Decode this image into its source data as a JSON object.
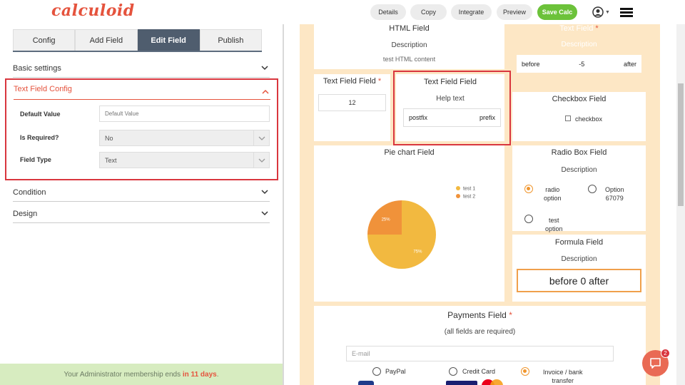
{
  "app": {
    "logo": "calculoid"
  },
  "nav": {
    "details": "Details",
    "copy": "Copy",
    "integrate": "Integrate",
    "preview": "Preview",
    "save": "Save Calc",
    "user_icon": "user-icon",
    "menu_icon": "hamburger-icon"
  },
  "tabs": [
    {
      "label": "Config"
    },
    {
      "label": "Add Field"
    },
    {
      "label": "Edit Field"
    },
    {
      "label": "Publish"
    }
  ],
  "sections": {
    "basic": "Basic settings",
    "config": "Text Field Config",
    "condition": "Condition",
    "design": "Design"
  },
  "form": {
    "default_value_label": "Default Value",
    "default_value_placeholder": "Default Value",
    "required_label": "Is Required?",
    "required_value": "No",
    "type_label": "Field Type",
    "type_value": "Text"
  },
  "membership": {
    "prefix": "Your Administrator membership ends ",
    "highlight": "in 11 days",
    "suffix": "."
  },
  "preview": {
    "html_field": {
      "title": "HTML Field",
      "desc": "Description",
      "content": "test HTML content"
    },
    "text_field_top": {
      "title": "Text Field",
      "req": "*",
      "desc": "Description",
      "before": "before",
      "value": "-5",
      "after": "after"
    },
    "text_field_field": {
      "title": "Text Field Field",
      "req": "*",
      "value": "12"
    },
    "text_field_field2": {
      "title": "Text Field Field",
      "help": "Help text",
      "left": "postfix",
      "right": "prefix"
    },
    "checkbox": {
      "title": "Checkbox Field",
      "label": "checkbox"
    },
    "pie": {
      "title": "Pie chart Field"
    },
    "radio": {
      "title": "Radio Box Field",
      "desc": "Description",
      "opt1": "radio",
      "opt1b": "option",
      "opt2": "Option",
      "opt2b": "67079",
      "opt3": "test",
      "opt3b": "option"
    },
    "formula": {
      "title": "Formula Field",
      "desc": "Description",
      "value": "before 0 after"
    },
    "payments": {
      "title": "Payments Field",
      "req": "*",
      "desc": "(all fields are required)",
      "email_placeholder": "E-mail",
      "paypal": "PayPal",
      "card": "Credit Card",
      "invoice": "Invoice / bank",
      "invoice2": "transfer"
    }
  },
  "chart_data": {
    "type": "pie",
    "categories": [
      "test 1",
      "test 2"
    ],
    "values": [
      75,
      25
    ],
    "labels": [
      "75%",
      "25%"
    ],
    "colors": [
      "#f2b940",
      "#f0923a"
    ],
    "legend": "right"
  },
  "chat": {
    "badge": "2"
  },
  "colors": {
    "accent": "#e5533d",
    "green": "#6cc23a",
    "tab_active": "#4f5d6e",
    "preview_bg": "#fde7c5"
  }
}
